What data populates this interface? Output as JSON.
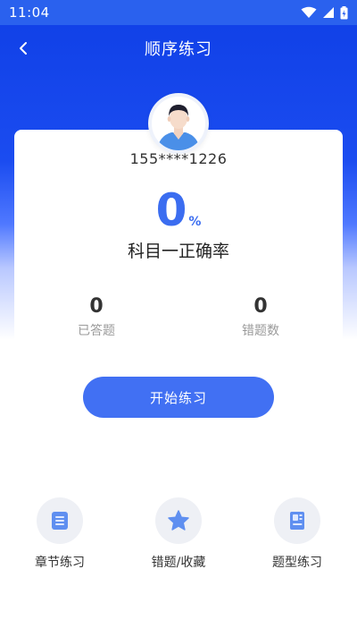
{
  "status_bar": {
    "time": "11:04"
  },
  "nav": {
    "title": "顺序练习"
  },
  "profile": {
    "phone": "155****1226"
  },
  "accuracy": {
    "value": "0",
    "unit": "%",
    "label": "科目一正确率"
  },
  "stats": [
    {
      "value": "0",
      "label": "已答题"
    },
    {
      "value": "0",
      "label": "错题数"
    }
  ],
  "start_button": {
    "label": "开始练习"
  },
  "menu": [
    {
      "label": "章节练习",
      "icon": "list-icon"
    },
    {
      "label": "错题/收藏",
      "icon": "star-icon"
    },
    {
      "label": "题型练习",
      "icon": "book-icon"
    }
  ],
  "colors": {
    "primary": "#4170f3",
    "header": "#1b4cf0",
    "text": "#333333",
    "muted": "#9a9a9a"
  }
}
